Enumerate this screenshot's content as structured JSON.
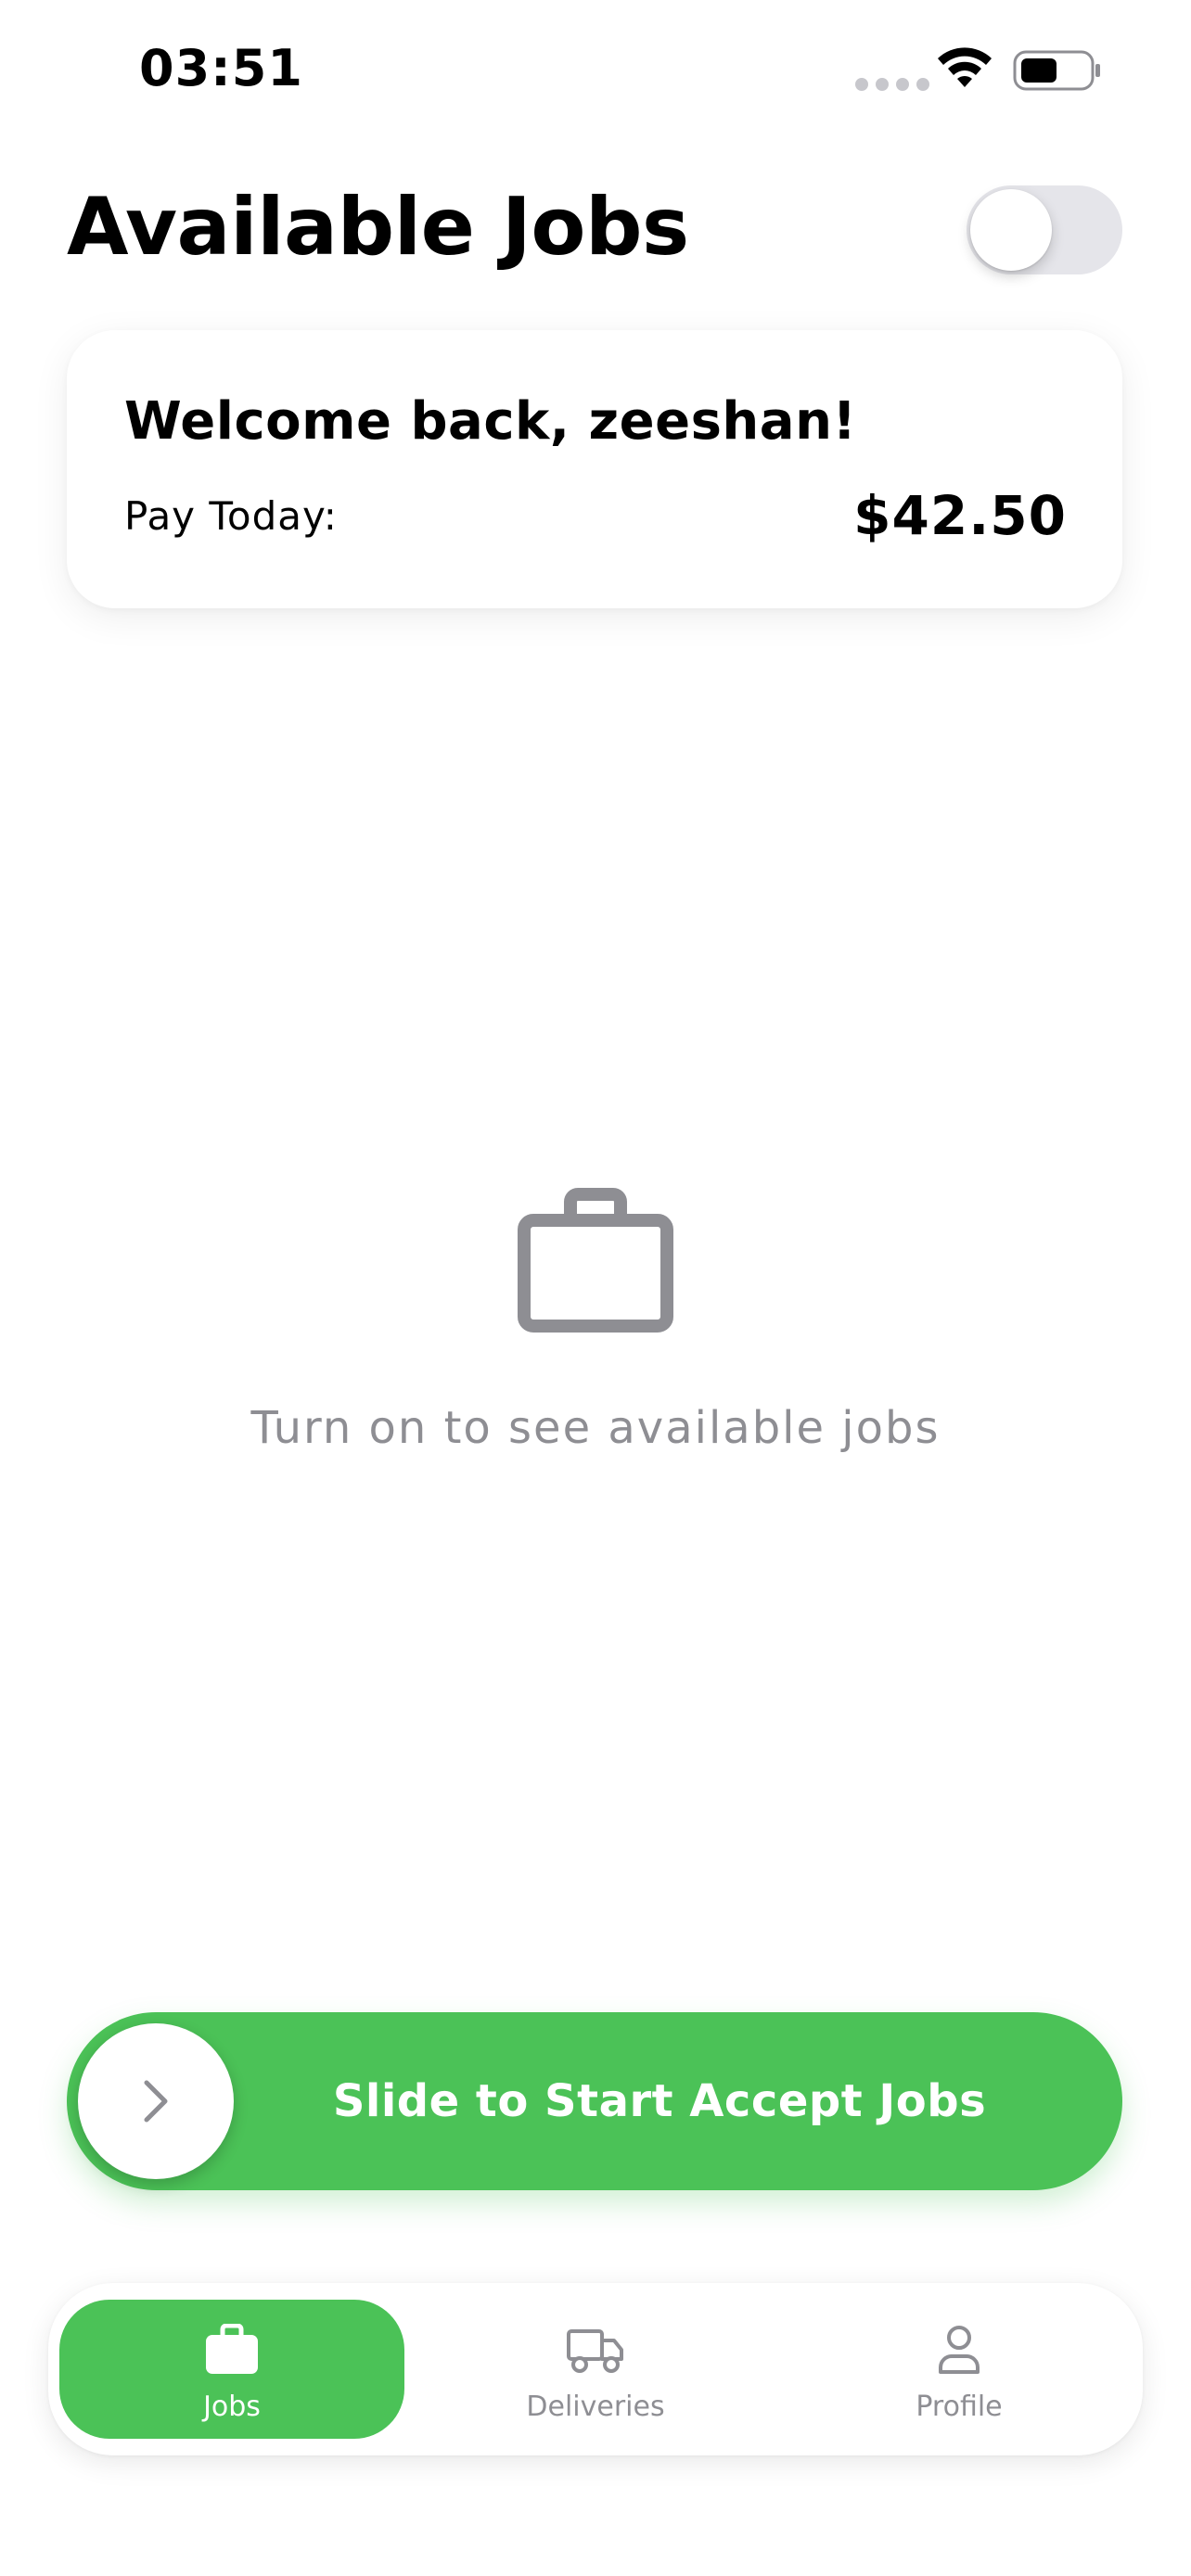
{
  "status_bar": {
    "time": "03:51",
    "icons": [
      "signal-dots-icon",
      "wifi-icon",
      "battery-icon"
    ]
  },
  "header": {
    "title": "Available Jobs",
    "online_toggle_on": false
  },
  "welcome_card": {
    "greeting": "Welcome back, zeeshan!",
    "pay_label": "Pay Today:",
    "pay_value": "$42.50"
  },
  "empty_state": {
    "icon": "briefcase-icon",
    "message": "Turn on to see available jobs"
  },
  "slide_button": {
    "label": "Slide to Start Accept Jobs",
    "icon": "chevron-right-icon"
  },
  "tab_bar": {
    "tabs": [
      {
        "label": "Jobs",
        "icon": "briefcase-icon",
        "active": true
      },
      {
        "label": "Deliveries",
        "icon": "truck-icon",
        "active": false
      },
      {
        "label": "Profile",
        "icon": "person-icon",
        "active": false
      }
    ]
  },
  "colors": {
    "accent_green": "#4bc257",
    "inactive_gray": "#8e8e93",
    "toggle_off": "#e5e5ea",
    "background": "#ffffff"
  }
}
